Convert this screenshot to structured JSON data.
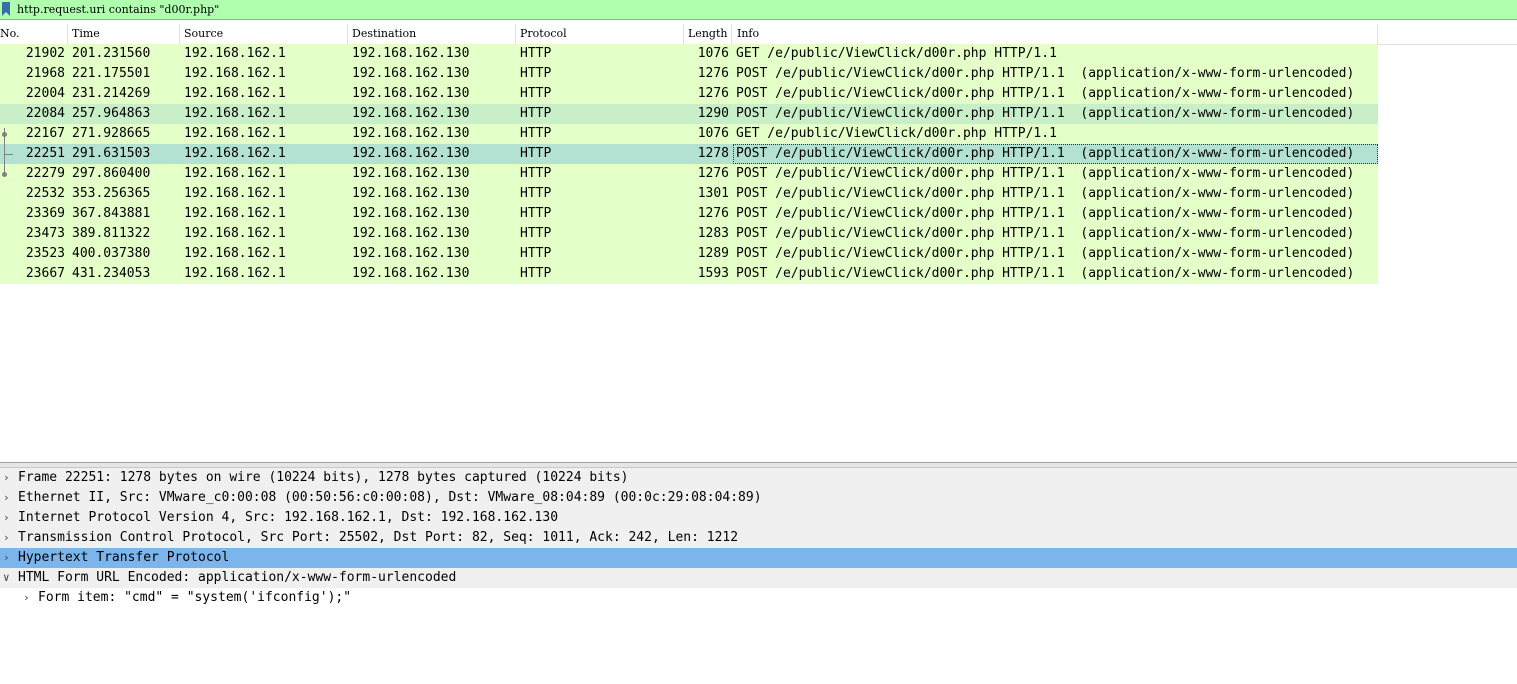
{
  "filter": {
    "text": "http.request.uri contains \"d00r.php\""
  },
  "columns": [
    "No.",
    "Time",
    "Source",
    "Destination",
    "Protocol",
    "Length",
    "Info"
  ],
  "packets": [
    {
      "no": "21902",
      "time": "201.231560",
      "src": "192.168.162.1",
      "dst": "192.168.162.130",
      "proto": "HTTP",
      "len": "1076",
      "info": "GET /e/public/ViewClick/d00r.php HTTP/1.1"
    },
    {
      "no": "21968",
      "time": "221.175501",
      "src": "192.168.162.1",
      "dst": "192.168.162.130",
      "proto": "HTTP",
      "len": "1276",
      "info": "POST /e/public/ViewClick/d00r.php HTTP/1.1  (application/x-www-form-urlencoded)"
    },
    {
      "no": "22004",
      "time": "231.214269",
      "src": "192.168.162.1",
      "dst": "192.168.162.130",
      "proto": "HTTP",
      "len": "1276",
      "info": "POST /e/public/ViewClick/d00r.php HTTP/1.1  (application/x-www-form-urlencoded)"
    },
    {
      "no": "22084",
      "time": "257.964863",
      "src": "192.168.162.1",
      "dst": "192.168.162.130",
      "proto": "HTTP",
      "len": "1290",
      "info": "POST /e/public/ViewClick/d00r.php HTTP/1.1  (application/x-www-form-urlencoded)"
    },
    {
      "no": "22167",
      "time": "271.928665",
      "src": "192.168.162.1",
      "dst": "192.168.162.130",
      "proto": "HTTP",
      "len": "1076",
      "info": "GET /e/public/ViewClick/d00r.php HTTP/1.1"
    },
    {
      "no": "22251",
      "time": "291.631503",
      "src": "192.168.162.1",
      "dst": "192.168.162.130",
      "proto": "HTTP",
      "len": "1278",
      "info": "POST /e/public/ViewClick/d00r.php HTTP/1.1  (application/x-www-form-urlencoded)"
    },
    {
      "no": "22279",
      "time": "297.860400",
      "src": "192.168.162.1",
      "dst": "192.168.162.130",
      "proto": "HTTP",
      "len": "1276",
      "info": "POST /e/public/ViewClick/d00r.php HTTP/1.1  (application/x-www-form-urlencoded)"
    },
    {
      "no": "22532",
      "time": "353.256365",
      "src": "192.168.162.1",
      "dst": "192.168.162.130",
      "proto": "HTTP",
      "len": "1301",
      "info": "POST /e/public/ViewClick/d00r.php HTTP/1.1  (application/x-www-form-urlencoded)"
    },
    {
      "no": "23369",
      "time": "367.843881",
      "src": "192.168.162.1",
      "dst": "192.168.162.130",
      "proto": "HTTP",
      "len": "1276",
      "info": "POST /e/public/ViewClick/d00r.php HTTP/1.1  (application/x-www-form-urlencoded)"
    },
    {
      "no": "23473",
      "time": "389.811322",
      "src": "192.168.162.1",
      "dst": "192.168.162.130",
      "proto": "HTTP",
      "len": "1283",
      "info": "POST /e/public/ViewClick/d00r.php HTTP/1.1  (application/x-www-form-urlencoded)"
    },
    {
      "no": "23523",
      "time": "400.037380",
      "src": "192.168.162.1",
      "dst": "192.168.162.130",
      "proto": "HTTP",
      "len": "1289",
      "info": "POST /e/public/ViewClick/d00r.php HTTP/1.1  (application/x-www-form-urlencoded)"
    },
    {
      "no": "23667",
      "time": "431.234053",
      "src": "192.168.162.1",
      "dst": "192.168.162.130",
      "proto": "HTTP",
      "len": "1593",
      "info": "POST /e/public/ViewClick/d00r.php HTTP/1.1  (application/x-www-form-urlencoded)"
    }
  ],
  "details": [
    {
      "text": "Frame 22251: 1278 bytes on wire (10224 bits), 1278 bytes captured (10224 bits)",
      "expanded": false
    },
    {
      "text": "Ethernet II, Src: VMware_c0:00:08 (00:50:56:c0:00:08), Dst: VMware_08:04:89 (00:0c:29:08:04:89)",
      "expanded": false
    },
    {
      "text": "Internet Protocol Version 4, Src: 192.168.162.1, Dst: 192.168.162.130",
      "expanded": false
    },
    {
      "text": "Transmission Control Protocol, Src Port: 25502, Dst Port: 82, Seq: 1011, Ack: 242, Len: 1212",
      "expanded": false
    },
    {
      "text": "Hypertext Transfer Protocol",
      "expanded": false
    },
    {
      "text": "HTML Form URL Encoded: application/x-www-form-urlencoded",
      "expanded": true
    },
    {
      "text": "Form item: \"cmd\" = \"system('ifconfig');\"",
      "expanded": false
    }
  ],
  "colors": {
    "filter_ok": "#afffaf",
    "http_row": "#e4ffc7",
    "selected_row": "#b4e2d2",
    "detail_selected": "#7cb5ec"
  }
}
